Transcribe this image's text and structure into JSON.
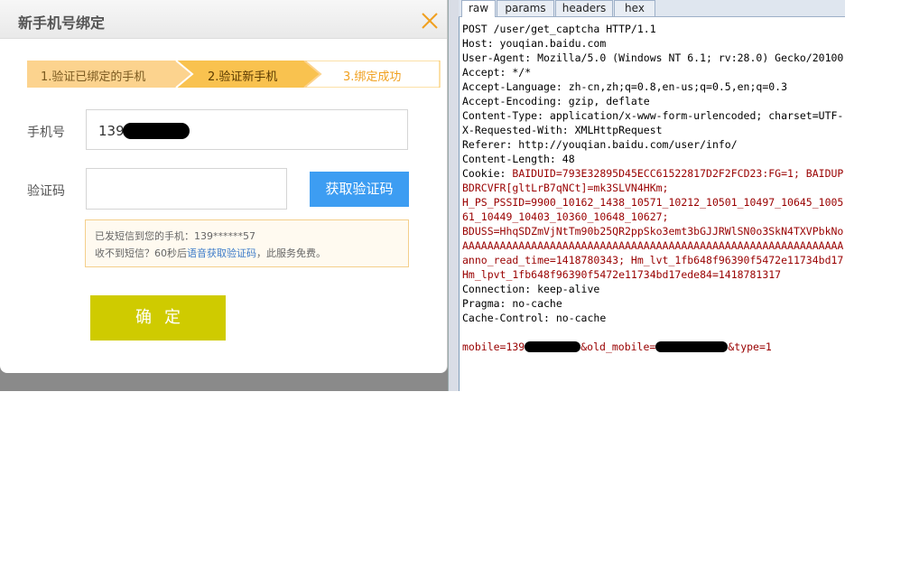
{
  "dialog": {
    "title": "新手机号绑定",
    "steps": [
      {
        "label": "1.验证已绑定的手机"
      },
      {
        "label": "2.验证新手机"
      },
      {
        "label": "3.绑定成功"
      }
    ],
    "phone_label": "手机号",
    "phone_value": "139",
    "code_label": "验证码",
    "code_value": "",
    "get_code_button": "获取验证码",
    "notice_line1": "已发短信到您的手机：139******57",
    "notice_line2_pre": "收不到短信？60秒后",
    "notice_link": "语音获取验证码",
    "notice_line2_post": "，此服务免费。",
    "confirm_button": "确定"
  },
  "request_viewer": {
    "tabs": [
      "raw",
      "params",
      "headers",
      "hex"
    ],
    "active_tab": "raw",
    "lines": {
      "l1": "POST /user/get_captcha HTTP/1.1",
      "l2": "Host: youqian.baidu.com",
      "l3": "User-Agent: Mozilla/5.0 (Windows NT 6.1; rv:28.0) Gecko/20100",
      "l4": "Accept: */*",
      "l5": "Accept-Language: zh-cn,zh;q=0.8,en-us;q=0.5,en;q=0.3",
      "l6": "Accept-Encoding: gzip, deflate",
      "l7": "Content-Type: application/x-www-form-urlencoded; charset=UTF-",
      "l8": "X-Requested-With: XMLHttpRequest",
      "l9": "Referer: http://youqian.baidu.com/user/info/",
      "l10": "Content-Length: 48",
      "l11k": "Cookie: ",
      "l11v": "BAIDUID=793E32895D45ECC61522817D2F2FCD23:FG=1; BAIDUP",
      "l12": "BDRCVFR[gltLrB7qNCt]=mk3SLVN4HKm;",
      "l13": "H_PS_PSSID=9900_10162_1438_10571_10212_10501_10497_10645_1005",
      "l14": "61_10449_10403_10360_10648_10627;",
      "l15": "BDUSS=HhqSDZmVjNtTm90b25QR2ppSko3emt3bGJJRWlSN0o3SkN4TXVPbkNo",
      "l16": "AAAAAAAAAAAAAAAAAAAAAAAAAAAAAAAAAAAAAAAAAAAAAAAAAAAAAAAAAAAAA",
      "l17": "anno_read_time=1418780343; Hm_lvt_1fb648f96390f5472e11734bd17",
      "l18": "Hm_lpvt_1fb648f96390f5472e11734bd17ede84=1418781317",
      "l19": "Connection: keep-alive",
      "l20": "Pragma: no-cache",
      "l21": "Cache-Control: no-cache",
      "l22a": "mobile=139",
      "l22b": "&old_mobile=",
      "l22c": "&type=1"
    }
  },
  "colors": {
    "step_done": "#fcd38e",
    "step_active": "#f9c24f",
    "step_pending_text": "#f0a020",
    "accent_blue": "#3d9df2",
    "confirm_green": "#cfcb00",
    "value_red": "#990000"
  },
  "icons": {
    "close": "close-icon"
  }
}
